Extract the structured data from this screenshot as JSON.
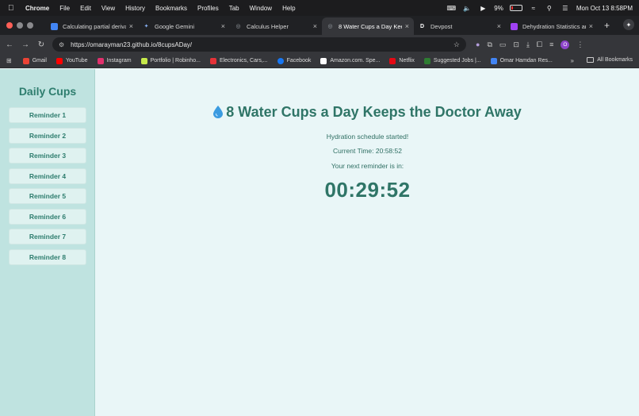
{
  "menubar": {
    "items": [
      "Chrome",
      "File",
      "Edit",
      "View",
      "History",
      "Bookmarks",
      "Profiles",
      "Tab",
      "Window",
      "Help"
    ],
    "battery": "9%",
    "datetime": "Mon Oct 13  8:58PM"
  },
  "tabs": [
    {
      "label": "Calculating partial deriva",
      "icon": "youtube-icon",
      "color": "#4285f4"
    },
    {
      "label": "Google Gemini",
      "icon": "gemini-icon",
      "color": "#8ab4f8"
    },
    {
      "label": "Calculus Helper",
      "icon": "globe-icon",
      "color": "#9aa0a6"
    },
    {
      "label": "8 Water Cups a Day Keep",
      "icon": "globe-icon",
      "color": "#9aa0a6",
      "active": true
    },
    {
      "label": "Devpost",
      "icon": "devpost-icon",
      "color": "#ffffff"
    },
    {
      "label": "Dehydration Statistics an",
      "icon": "chart-icon",
      "color": "#a142f4"
    }
  ],
  "toolbar": {
    "url": "https://omarayman23.github.io/8cupsADay/",
    "profile_initial": "O"
  },
  "bookmarks": {
    "items": [
      {
        "label": "Gmail",
        "color": "#ea4335"
      },
      {
        "label": "YouTube",
        "color": "#ff0000"
      },
      {
        "label": "Instagram",
        "color": "#e1306c"
      },
      {
        "label": "Portfolio | Robinho...",
        "color": "#c6e94b"
      },
      {
        "label": "Electronics, Cars,...",
        "color": "#e53238"
      },
      {
        "label": "Facebook",
        "color": "#1877f2"
      },
      {
        "label": "Amazon.com. Spe...",
        "color": "#ffffff"
      },
      {
        "label": "Netflix",
        "color": "#e50914"
      },
      {
        "label": "Suggested Jobs |...",
        "color": "#2e7d32"
      },
      {
        "label": "Omar Hamdan Res...",
        "color": "#4285f4"
      }
    ],
    "more": "»",
    "all_label": "All Bookmarks"
  },
  "sidebar": {
    "title": "Daily Cups",
    "reminders": [
      "Reminder 1",
      "Reminder 2",
      "Reminder 3",
      "Reminder 4",
      "Reminder 5",
      "Reminder 6",
      "Reminder 7",
      "Reminder 8"
    ]
  },
  "main": {
    "title": "8 Water Cups a Day Keeps the Doctor Away",
    "status": "Hydration schedule started!",
    "current_time": "Current Time: 20:58:52",
    "next_label": "Your next reminder is in:",
    "countdown": "00:29:52"
  }
}
